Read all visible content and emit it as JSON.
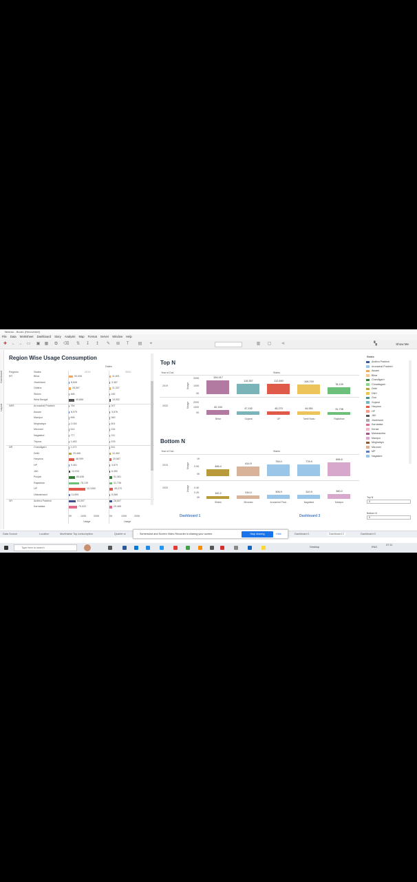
{
  "window": {
    "title": "Tableau - Book1 [Recovered]"
  },
  "menu": [
    "File",
    "Data",
    "Worksheet",
    "Dashboard",
    "Story",
    "Analysis",
    "Map",
    "Format",
    "Server",
    "Window",
    "Help"
  ],
  "toolbar": {
    "show_me": "Show Me"
  },
  "side_tabs": [
    "Dashboard",
    "Layout"
  ],
  "region_panel": {
    "title": "Region Wise Usage Consumption",
    "header_regions": "Regions",
    "header_states": "States",
    "header_dates": "Dates",
    "year_2019": "2019",
    "year_2020": "2020",
    "footer_label": "Usage",
    "axis_ticks": [
      "0K",
      "100K",
      "200K"
    ],
    "rows": [
      {
        "region": "ER",
        "state": "Bihar",
        "v19": "90,006",
        "w19": 6,
        "c19": "#f2a65a",
        "v20": "11,821",
        "w20": 2
      },
      {
        "region": "",
        "state": "Jharkhand",
        "v19": "8,606",
        "w19": 1,
        "c19": "#5b7dbb",
        "v20": "3,387",
        "w20": 1
      },
      {
        "region": "",
        "state": "Odisha",
        "v19": "28,567",
        "w19": 3,
        "c19": "#f2a65a",
        "v20": "11,337",
        "w20": 2
      },
      {
        "region": "",
        "state": "Sikkim",
        "v19": "466",
        "w19": 0.5,
        "c19": "#999",
        "v20": "182",
        "w20": 0.5
      },
      {
        "region": "",
        "state": "West Bengal",
        "v19": "49,868",
        "w19": 8,
        "c19": "#555",
        "v20": "19,902",
        "w20": 2
      },
      {
        "region": "NER",
        "state": "Arunachal Pradesh",
        "v19": "754",
        "w19": 0.5,
        "c19": "#999",
        "v20": "307",
        "w20": 0.5
      },
      {
        "region": "",
        "state": "Assam",
        "v19": "8,979",
        "w19": 1,
        "c19": "#5b7dbb",
        "v20": "3,576",
        "w20": 1
      },
      {
        "region": "",
        "state": "Manipur",
        "v19": "896",
        "w19": 0.5,
        "c19": "#999",
        "v20": "360",
        "w20": 0.5
      },
      {
        "region": "",
        "state": "Meghalaya",
        "v19": "2,016",
        "w19": 0.5,
        "c19": "#999",
        "v20": "601",
        "w20": 0.5
      },
      {
        "region": "",
        "state": "Mizoram",
        "v19": "614",
        "w19": 0.5,
        "c19": "#999",
        "v20": "244",
        "w20": 0.5
      },
      {
        "region": "",
        "state": "Nagaland",
        "v19": "777",
        "w19": 0.5,
        "c19": "#999",
        "v20": "311",
        "w20": 0.5
      },
      {
        "region": "",
        "state": "Tripura",
        "v19": "1,483",
        "w19": 0.5,
        "c19": "#999",
        "v20": "578",
        "w20": 0.5
      },
      {
        "region": "NR",
        "state": "Chandigarh",
        "v19": "1,472",
        "w19": 0.5,
        "c19": "#999",
        "v20": "611",
        "w20": 0.5
      },
      {
        "region": "",
        "state": "Delhi",
        "v19": "29,466",
        "w19": 4,
        "c19": "#b5a642",
        "v20": "10,462",
        "w20": 2
      },
      {
        "region": "",
        "state": "Haryana",
        "v19": "48,999",
        "w19": 8,
        "c19": "#e05a4a",
        "v20": "20,687",
        "w20": 3
      },
      {
        "region": "",
        "state": "HP",
        "v19": "9,461",
        "w19": 1,
        "c19": "#5b7dbb",
        "v20": "3,873",
        "w20": 1
      },
      {
        "region": "",
        "state": "J&K",
        "v19": "13,915",
        "w19": 2,
        "c19": "#444",
        "v20": "6,350",
        "w20": 1
      },
      {
        "region": "",
        "state": "Punjab",
        "v19": "85,636",
        "w19": 9,
        "c19": "#3a7d3a",
        "v20": "31,361",
        "w20": 4
      },
      {
        "region": "",
        "state": "Rajasthan",
        "v19": "78,139",
        "w19": 15,
        "c19": "#6cc07a",
        "v20": "31,738",
        "w20": 4
      },
      {
        "region": "",
        "state": "UP",
        "v19": "112,690",
        "w19": 24,
        "c19": "#e05a4a",
        "v20": "45,270",
        "w20": 5
      },
      {
        "region": "",
        "state": "Uttarakhand",
        "v19": "11,899",
        "w19": 1.5,
        "c19": "#5b7dbb",
        "v20": "5,088",
        "w20": 1
      },
      {
        "region": "SR",
        "state": "Andhra Pradesh",
        "v19": "63,097",
        "w19": 10,
        "c19": "#3d4f8f",
        "v20": "28,607",
        "w20": 4
      },
      {
        "region": "",
        "state": "Karnataka",
        "v19": "79,022",
        "w19": 12,
        "c19": "#e06a8a",
        "v20": "29,485",
        "w20": 4
      }
    ]
  },
  "top_n": {
    "title": "Top N",
    "col_year": "Year of Dat..",
    "col_states": "States",
    "y_label": "Usage",
    "rows": [
      {
        "year": "2019",
        "ticks": [
          "200K",
          "100K",
          "0K"
        ]
      },
      {
        "year": "2020",
        "ticks": [
          "2000",
          "1000",
          "0K"
        ]
      }
    ],
    "categories": [
      "Bihar",
      "Gujarat",
      "UP",
      "Tamil Nadu",
      "Rajasthan"
    ],
    "colors": [
      "#b27aa1",
      "#7ab3b8",
      "#e05a4a",
      "#edc45a",
      "#6cc07a"
    ],
    "values_2019": [
      "154,917",
      "115,357",
      "112,690",
      "106,700",
      "78,139"
    ],
    "values_2020": [
      "62,163",
      "47,152",
      "45,270",
      "44,551",
      "31,738"
    ]
  },
  "bottom_n": {
    "title": "Bottom N",
    "col_year": "Year of Dat..",
    "col_states": "States",
    "y_label": "Usage",
    "rows": [
      {
        "year": "2019",
        "ticks": [
          "1K",
          "0.5K",
          "0K"
        ]
      },
      {
        "year": "2020",
        "ticks": [
          "0.4K",
          "0.2K",
          "0K"
        ]
      }
    ],
    "categories": [
      "Sikkim",
      "Mizoram",
      "Arunachal Prad..",
      "Nagaland",
      "Manipur"
    ],
    "colors": [
      "#b89a3a",
      "#d9b399",
      "#9cc6e8",
      "#9cc6e8",
      "#d7a8cc"
    ],
    "values_2019": [
      "466.4",
      "614.5",
      "754.0",
      "776.9",
      "896.5"
    ],
    "values_2020": [
      "182.2",
      "244.0",
      "306.9",
      "310.9",
      "360.2"
    ]
  },
  "dashboard_labels": [
    "Dashboard 1",
    "Dashboard 3"
  ],
  "legend": {
    "title": "States",
    "items": [
      {
        "name": "Andhra Pradesh",
        "color": "#3d5a99"
      },
      {
        "name": "Arunachal Pradesh",
        "color": "#9cc6e8"
      },
      {
        "name": "Assam",
        "color": "#f2a65a"
      },
      {
        "name": "Bihar",
        "color": "#f6c78f"
      },
      {
        "name": "Chandigarh",
        "color": "#3a7d3a"
      },
      {
        "name": "Chhattisgarh",
        "color": "#8fd18f"
      },
      {
        "name": "Delhi",
        "color": "#b5a642"
      },
      {
        "name": "DNH",
        "color": "#edc45a"
      },
      {
        "name": "Goa",
        "color": "#4a8f8f"
      },
      {
        "name": "Gujarat",
        "color": "#7ab3b8"
      },
      {
        "name": "Haryana",
        "color": "#e05a4a"
      },
      {
        "name": "HP",
        "color": "#f29b8a"
      },
      {
        "name": "J&K",
        "color": "#555555"
      },
      {
        "name": "Jharkhand",
        "color": "#aaaaaa"
      },
      {
        "name": "Karnataka",
        "color": "#e06a8a"
      },
      {
        "name": "Kerala",
        "color": "#f2b6c6"
      },
      {
        "name": "Maharashtra",
        "color": "#9b5a8a"
      },
      {
        "name": "Manipur",
        "color": "#d7a8cc"
      },
      {
        "name": "Meghalaya",
        "color": "#8c5a3a"
      },
      {
        "name": "Mizoram",
        "color": "#d9b399"
      },
      {
        "name": "MP",
        "color": "#5b7dbb"
      },
      {
        "name": "Nagaland",
        "color": "#9cc6e8"
      }
    ]
  },
  "filters": {
    "top_n_label": "Top N",
    "top_n_value": "5",
    "bottom_n_label": "Bottom N",
    "bottom_n_value": "5"
  },
  "sheet_tabs": [
    "Data Source",
    "Location",
    "Monthwise Top consumption",
    "Quarter w",
    "Dashboard 1",
    "Dashboard 2",
    "Dashboard 3"
  ],
  "share_bar": {
    "message": "Screenshot and Screen Video Recorder is sharing your screen.",
    "stop": "Stop sharing",
    "hide": "Hide"
  },
  "taskbar": {
    "search_placeholder": "Type here to search",
    "desktop": "Desktop",
    "time": "07:11",
    "lang": "ENG"
  }
}
